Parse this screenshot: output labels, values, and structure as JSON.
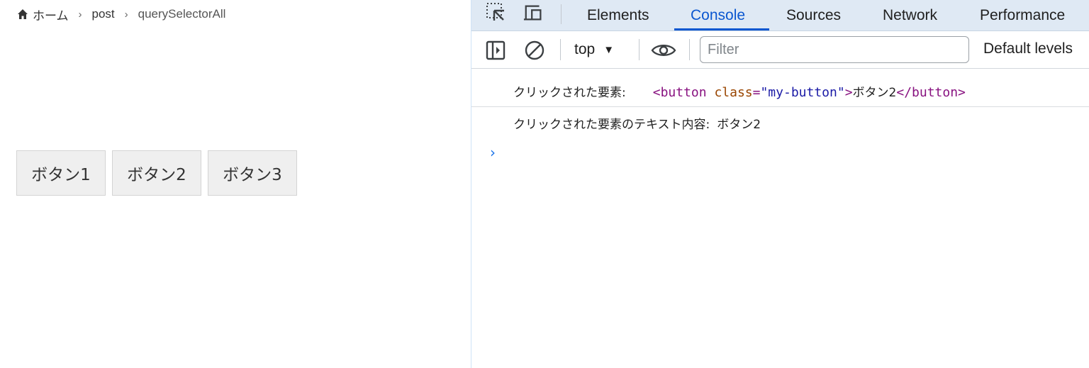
{
  "page": {
    "breadcrumb": {
      "items": [
        "ホーム",
        "post",
        "querySelectorAll"
      ],
      "separator": "›"
    },
    "buttons": [
      "ボタン1",
      "ボタン2",
      "ボタン3"
    ]
  },
  "devtools": {
    "tabs": [
      "Elements",
      "Console",
      "Sources",
      "Network",
      "Performance"
    ],
    "active_tab": "Console",
    "toolbar": {
      "context": "top",
      "filter_placeholder": "Filter",
      "levels": "Default levels"
    },
    "console": {
      "messages": [
        {
          "label": "クリックされた要素:",
          "html": {
            "open_tag_start": "<button",
            "attr_name": "class",
            "attr_eq": "=",
            "attr_value": "\"my-button\"",
            "open_tag_end": ">",
            "text": "ボタン2",
            "close_tag": "</button>"
          }
        },
        {
          "label": "クリックされた要素のテキスト内容:",
          "value": "ボタン2"
        }
      ],
      "prompt": "›"
    },
    "colors": {
      "accent": "#0b57d0",
      "tab_bar": "#dfe9f4",
      "tag": "#881280",
      "attr_name": "#994500",
      "attr_value": "#1a1aa6"
    }
  }
}
